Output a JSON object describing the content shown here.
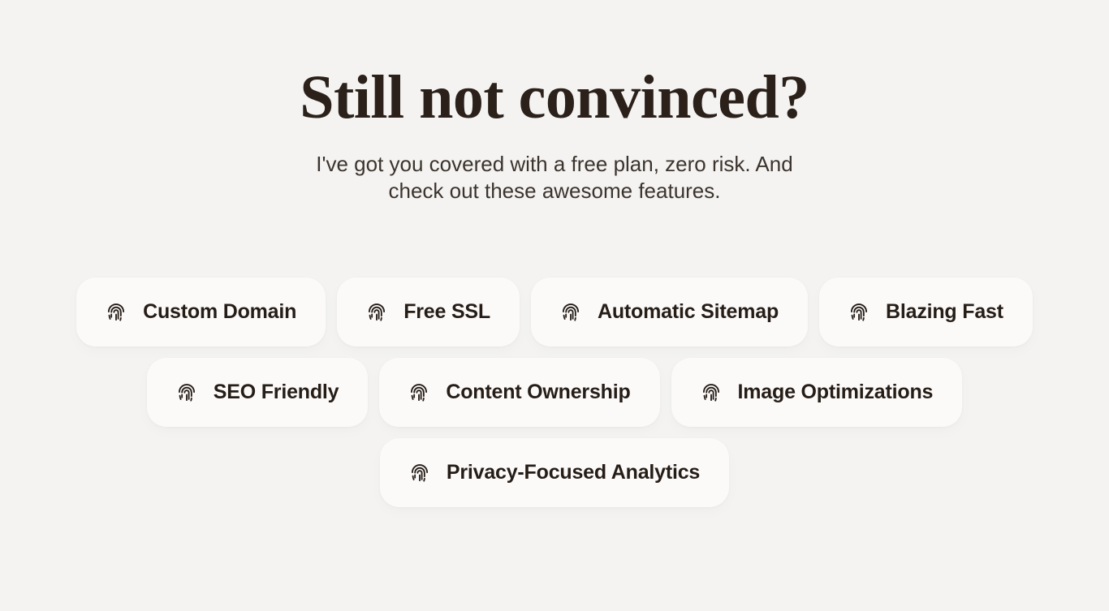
{
  "page": {
    "background_color": "#f4f3f1"
  },
  "header": {
    "title": "Still not convinced?",
    "title_color": "#2b211a",
    "subtitle": "I've got you covered with a free plan, zero risk. And check out these awesome features.",
    "subtitle_color": "#3b342e"
  },
  "features": {
    "card_background_color": "#fbfaf9",
    "label_color": "#261d17",
    "icon_name": "fingerprint-icon",
    "rows": [
      {
        "items": [
          {
            "label": "Custom Domain",
            "icon": "fingerprint-icon"
          },
          {
            "label": "Free SSL",
            "icon": "fingerprint-icon"
          },
          {
            "label": "Automatic Sitemap",
            "icon": "fingerprint-icon"
          },
          {
            "label": "Blazing Fast",
            "icon": "fingerprint-icon"
          }
        ]
      },
      {
        "items": [
          {
            "label": "SEO Friendly",
            "icon": "fingerprint-icon"
          },
          {
            "label": "Content Ownership",
            "icon": "fingerprint-icon"
          },
          {
            "label": "Image Optimizations",
            "icon": "fingerprint-icon"
          }
        ]
      },
      {
        "items": [
          {
            "label": "Privacy-Focused Analytics",
            "icon": "fingerprint-icon"
          }
        ]
      }
    ]
  }
}
